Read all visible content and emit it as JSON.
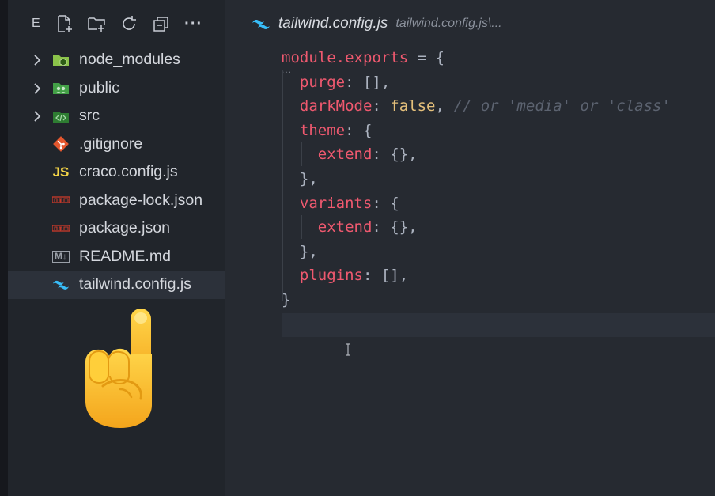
{
  "sidebar": {
    "header_label": "E",
    "toolbar_icons": [
      "new-file-icon",
      "new-folder-icon",
      "refresh-icon",
      "collapse-all-icon",
      "more-icon"
    ],
    "more_label": "···",
    "tree": [
      {
        "label": "node_modules",
        "type": "folder",
        "icon": "nodejs-folder-icon"
      },
      {
        "label": "public",
        "type": "folder",
        "icon": "public-folder-icon"
      },
      {
        "label": "src",
        "type": "folder",
        "icon": "src-folder-icon"
      },
      {
        "label": ".gitignore",
        "type": "file",
        "icon": "git-icon"
      },
      {
        "label": "craco.config.js",
        "type": "file",
        "icon": "js-icon",
        "icon_text": "JS"
      },
      {
        "label": "package-lock.json",
        "type": "file",
        "icon": "npm-icon"
      },
      {
        "label": "package.json",
        "type": "file",
        "icon": "npm-icon"
      },
      {
        "label": "README.md",
        "type": "file",
        "icon": "markdown-icon",
        "icon_text": "M↓"
      },
      {
        "label": "tailwind.config.js",
        "type": "file",
        "icon": "tailwind-icon",
        "selected": true
      }
    ]
  },
  "editor": {
    "tab_title": "tailwind.config.js",
    "tab_path": "tailwind.config.js\\...",
    "folding_dots": "...",
    "code_lines": [
      {
        "tokens": [
          {
            "t": "module.exports",
            "c": "key"
          },
          {
            "t": " = {",
            "c": "punc"
          }
        ]
      },
      {
        "tokens": [
          {
            "t": "  ",
            "c": "punc"
          },
          {
            "t": "purge",
            "c": "key"
          },
          {
            "t": ": [],",
            "c": "punc"
          }
        ]
      },
      {
        "tokens": [
          {
            "t": "  ",
            "c": "punc"
          },
          {
            "t": "darkMode",
            "c": "key"
          },
          {
            "t": ": ",
            "c": "punc"
          },
          {
            "t": "false",
            "c": "bool"
          },
          {
            "t": ", ",
            "c": "punc"
          },
          {
            "t": "// or 'media' or 'class'",
            "c": "cmt"
          }
        ]
      },
      {
        "tokens": [
          {
            "t": "  ",
            "c": "punc"
          },
          {
            "t": "theme",
            "c": "key"
          },
          {
            "t": ": {",
            "c": "punc"
          }
        ]
      },
      {
        "tokens": [
          {
            "t": "    ",
            "c": "punc"
          },
          {
            "t": "extend",
            "c": "key"
          },
          {
            "t": ": {},",
            "c": "punc"
          }
        ]
      },
      {
        "tokens": [
          {
            "t": "  },",
            "c": "punc"
          }
        ]
      },
      {
        "tokens": [
          {
            "t": "  ",
            "c": "punc"
          },
          {
            "t": "variants",
            "c": "key"
          },
          {
            "t": ": {",
            "c": "punc"
          }
        ]
      },
      {
        "tokens": [
          {
            "t": "    ",
            "c": "punc"
          },
          {
            "t": "extend",
            "c": "key"
          },
          {
            "t": ": {},",
            "c": "punc"
          }
        ]
      },
      {
        "tokens": [
          {
            "t": "  },",
            "c": "punc"
          }
        ]
      },
      {
        "tokens": [
          {
            "t": "  ",
            "c": "punc"
          },
          {
            "t": "plugins",
            "c": "key"
          },
          {
            "t": ": [],",
            "c": "punc"
          }
        ]
      },
      {
        "tokens": [
          {
            "t": "}",
            "c": "punc"
          }
        ]
      },
      {
        "tokens": []
      }
    ]
  },
  "overlay": {
    "icon": "pointing-up-hand-icon"
  },
  "colors": {
    "key": "#ef596f",
    "punc": "#abb2bf",
    "bool": "#e5c07b",
    "comment": "#5c6370",
    "tailwind": "#38bdf8"
  }
}
